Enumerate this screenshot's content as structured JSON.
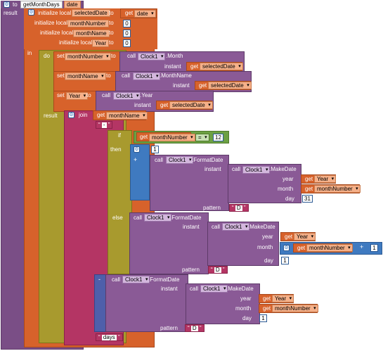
{
  "proc": {
    "to": "to",
    "name": "getMonthDays",
    "param": "date",
    "result": "result"
  },
  "init": [
    {
      "label": "initialize local",
      "var": "selectedDate",
      "to": "to",
      "value_get": "get",
      "value": "date"
    },
    {
      "label": "initialize local",
      "var": "monthNumber",
      "to": "to",
      "value": "0"
    },
    {
      "label": "initialize local",
      "var": "monthName",
      "to": "to",
      "value": "0"
    },
    {
      "label": "initialize local",
      "var": "Year",
      "to": "to",
      "value": "0"
    }
  ],
  "kw": {
    "in": "in",
    "do": "do",
    "result": "result",
    "join": "join",
    "if": "if",
    "then": "then",
    "else": "else",
    "get": "get",
    "call": "call",
    "instant": "instant",
    "year": "year",
    "month": "month",
    "day": "day",
    "pattern": "pattern",
    "set": "set"
  },
  "sets": [
    {
      "var": "monthNumber",
      "comp": "Clock1",
      "method": ".Month",
      "arg": "selectedDate"
    },
    {
      "var": "monthName",
      "comp": "Clock1",
      "method": ".MonthName",
      "arg": "selectedDate"
    },
    {
      "var": "Year",
      "comp": "Clock1",
      "method": ".Year",
      "arg": "selectedDate"
    }
  ],
  "join_get": "monthName",
  "sep": "-",
  "cond": {
    "var": "monthNumber",
    "op": "=",
    "value": "12"
  },
  "then": {
    "num": "1",
    "comp": "Clock1",
    "method": ".FormatDate",
    "make": ".MakeDate",
    "year": "Year",
    "month": "monthNumber",
    "day": "31",
    "pattern": "D"
  },
  "else": {
    "comp": "Clock1",
    "method": ".FormatDate",
    "make": ".MakeDate",
    "year": "Year",
    "month": "monthNumber",
    "plus": "+",
    "add": "1",
    "day": "1",
    "pattern": "D"
  },
  "minus": {
    "sign": "-",
    "comp": "Clock1",
    "method": ".FormatDate",
    "make": ".MakeDate",
    "year": "Year",
    "month": "monthNumber",
    "day": "1",
    "pattern": "D"
  },
  "suffix": "days",
  "colors": {
    "procedure": "#7a4e86",
    "variable": "#d7622b",
    "control": "#a89a2e",
    "text": "#b43564",
    "math": "#3f7ac0",
    "logic": "#6ca043"
  }
}
